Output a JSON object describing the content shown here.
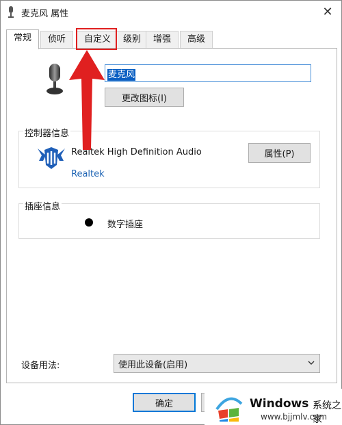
{
  "window": {
    "title": "麦克风 属性",
    "close_symbol": "✕"
  },
  "tabs": [
    {
      "label": "常规",
      "active": true
    },
    {
      "label": "侦听",
      "active": false
    },
    {
      "label": "自定义",
      "active": false,
      "highlighted": true
    },
    {
      "label": "级别",
      "active": false
    },
    {
      "label": "增强",
      "active": false
    },
    {
      "label": "高级",
      "active": false
    }
  ],
  "general": {
    "device_name_value": "麦克风",
    "change_icon_label": "更改图标(I)"
  },
  "controller": {
    "group_label": "控制器信息",
    "device_name": "Realtek High Definition Audio",
    "vendor": "Realtek",
    "properties_label": "属性(P)"
  },
  "jack": {
    "group_label": "插座信息",
    "type": "数字插座"
  },
  "usage": {
    "label": "设备用法:",
    "selected": "使用此设备(启用)"
  },
  "footer": {
    "ok_label": "确定"
  },
  "watermark": {
    "brand": "Windows",
    "cn_text": "系统之家",
    "url": "www.bjjmlv.com"
  },
  "colors": {
    "highlight": "#e02020",
    "selection": "#0a5fc2",
    "link": "#1e64b4",
    "accent": "#0078d7"
  }
}
